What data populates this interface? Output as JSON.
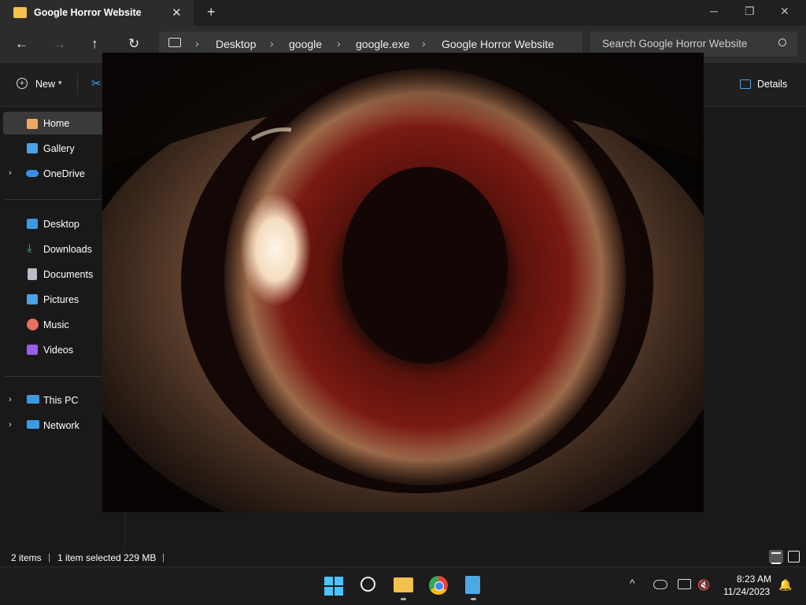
{
  "window": {
    "tab_title": "Google Horror Website",
    "close_tab": "✕",
    "new_tab": "+",
    "minimize": "─",
    "maximize": "❐",
    "close": "✕"
  },
  "nav": {
    "back": "←",
    "forward": "→",
    "up": "↑",
    "refresh": "↻",
    "breadcrumbs": [
      "Desktop",
      "google",
      "google.exe",
      "Google Horror Website"
    ],
    "search_placeholder": "Search Google Horror Website"
  },
  "toolbar": {
    "new_label": "New",
    "details_label": "Details"
  },
  "sidebar": {
    "items": [
      {
        "label": "Home",
        "icon": "home-icon",
        "color": "#f0a860"
      },
      {
        "label": "Gallery",
        "icon": "gallery-icon",
        "color": "#4aa3e8"
      },
      {
        "label": "OneDrive",
        "icon": "onedrive-icon",
        "color": "#3a8ee6"
      },
      {
        "label": "Desktop",
        "icon": "desktop-icon",
        "color": "#3c9be0"
      },
      {
        "label": "Downloads",
        "icon": "downloads-icon",
        "color": "#3cc07a"
      },
      {
        "label": "Documents",
        "icon": "documents-icon",
        "color": "#b8bcc6"
      },
      {
        "label": "Pictures",
        "icon": "pictures-icon",
        "color": "#4aa3e8"
      },
      {
        "label": "Music",
        "icon": "music-icon",
        "color": "#e87060"
      },
      {
        "label": "Videos",
        "icon": "videos-icon",
        "color": "#9b5de5"
      },
      {
        "label": "This PC",
        "icon": "this-pc-icon",
        "color": "#3c9be0"
      },
      {
        "label": "Network",
        "icon": "network-icon",
        "color": "#3c9be0"
      }
    ]
  },
  "status": {
    "items": "2 items",
    "selected": "1 item selected",
    "size": "229 MB"
  },
  "taskbar": {
    "time": "8:23 AM",
    "date": "11/24/2023"
  }
}
